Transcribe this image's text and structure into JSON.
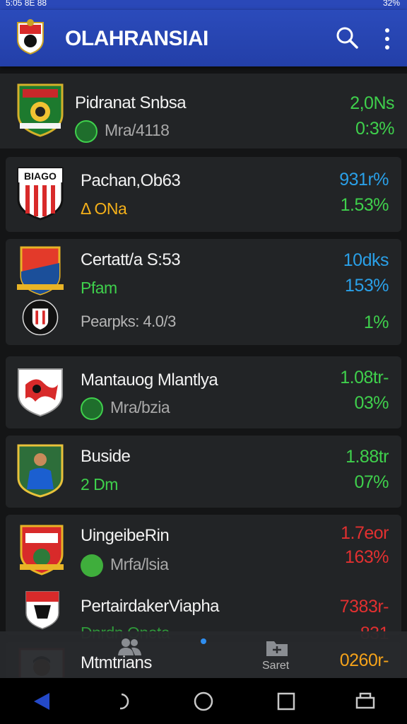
{
  "status": {
    "left": "5:05 8E 88",
    "right": "32%"
  },
  "app": {
    "title": "OLAHRANSIAI"
  },
  "colors": {
    "appbar": "#2b4bbb",
    "green": "#3fd04c",
    "blue": "#2aa0e8",
    "red": "#e23030",
    "orange": "#f4a21a",
    "card": "#222426"
  },
  "items": [
    {
      "name": "Pidranat Snbsa",
      "sub": "Mra/4118",
      "sub_color": "#a9a9a9",
      "sub_icon": "green-badge-icon",
      "v1": "2,0Ns",
      "v2": "0:3%",
      "v1_color": "#3fd04c",
      "v2_color": "#3fd04c"
    },
    {
      "name": "Pachan,Ob63",
      "sub": "Δ ONa",
      "sub_color": "#f4b01a",
      "v1": "931r%",
      "v2": "1.53%",
      "v1_color": "#2aa0e8",
      "v2_color": "#3fd04c"
    },
    {
      "name": "Certatt/a S:53",
      "sub": "Pfam",
      "sub_color": "#3fd04c",
      "v1": "10dks",
      "v2": "153%",
      "v1_color": "#2aa0e8",
      "v2_color": "#2aa0e8",
      "row2": "Pearpks: 4.0/3",
      "row2_val": "1%",
      "row2_color": "#3fd04c"
    },
    {
      "name": "Mantauog Mlantlya",
      "sub": "Mra/bzia",
      "sub_color": "#a9a9a9",
      "sub_icon": "green-badge-icon",
      "v1": "1.08tr-",
      "v2": "03%",
      "v1_color": "#3fd04c",
      "v2_color": "#3fd04c"
    },
    {
      "name": "Buside",
      "sub": "2 Dm",
      "sub_color": "#3fd04c",
      "v1": "1.88tr",
      "v2": "07%",
      "v1_color": "#3fd04c",
      "v2_color": "#3fd04c"
    },
    {
      "name": "UingeibeRin",
      "sub": "Mrfa/lsia",
      "sub_color": "#a9a9a9",
      "sub_icon": "green-plus-icon",
      "v1": "1.7eor",
      "v2": "163%",
      "v1_color": "#e23030",
      "v2_color": "#e23030",
      "row2": "PertairdakerViapha",
      "row2_val": "7383r-",
      "row2_color": "#e23030",
      "row3": "Dnrdn Oneta",
      "row3_val": "831",
      "row3_color": "#e23030"
    },
    {
      "name": "Mtmtrians",
      "v1": "0260r-",
      "v1_color": "#f4a21a"
    }
  ],
  "bottom_nav": {
    "folder_label": "Saret"
  },
  "icons": [
    "search-icon",
    "more-vert-icon",
    "people-icon",
    "folder-icon",
    "back-icon",
    "home-icon",
    "recents-icon",
    "screenshot-icon"
  ]
}
